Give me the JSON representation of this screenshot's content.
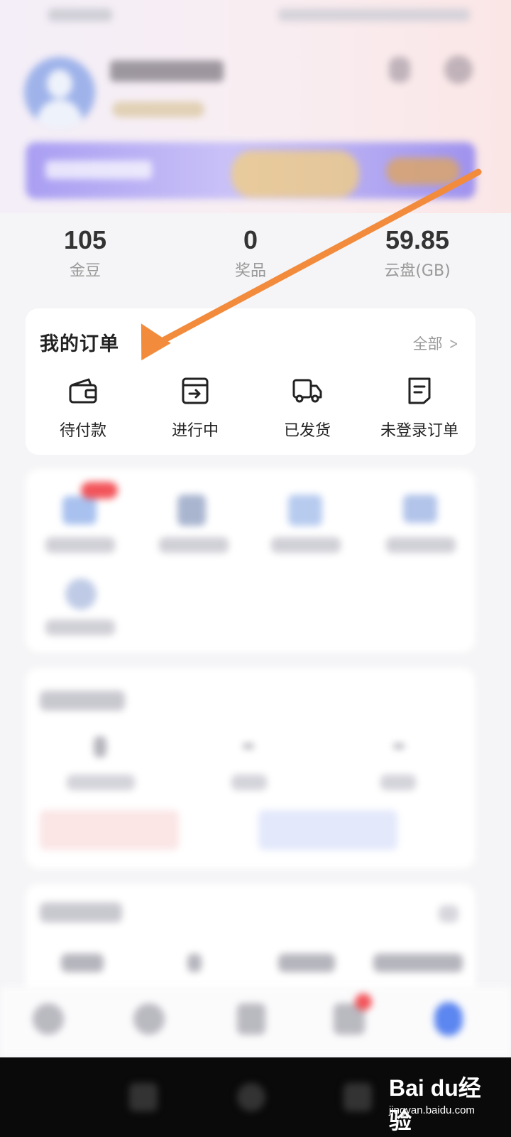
{
  "stats": [
    {
      "value": "105",
      "label": "金豆"
    },
    {
      "value": "0",
      "label": "奖品"
    },
    {
      "value": "59.85",
      "label": "云盘(GB)"
    }
  ],
  "orders": {
    "title": "我的订单",
    "view_all": "全部",
    "items": [
      {
        "label": "待付款",
        "icon": "wallet-icon"
      },
      {
        "label": "进行中",
        "icon": "box-arrow-icon"
      },
      {
        "label": "已发货",
        "icon": "truck-icon"
      },
      {
        "label": "未登录订单",
        "icon": "receipt-icon"
      }
    ]
  },
  "colors": {
    "annotation_arrow": "#f28b3c",
    "banner": "#b3a8f2",
    "avatar": "#9fb3ea"
  },
  "watermark": {
    "brand": "Bai  du经验",
    "site": "jingyan.baidu.com"
  }
}
